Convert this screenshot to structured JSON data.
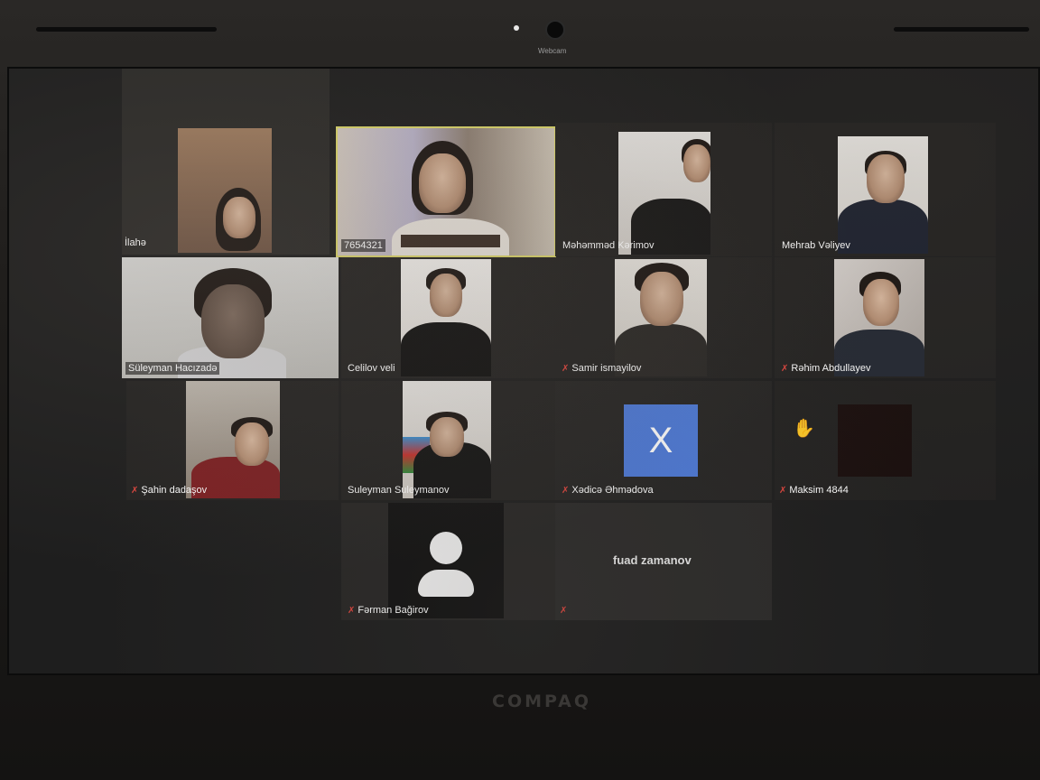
{
  "device": {
    "webcam_label": "Webcam",
    "brand": "COMPAQ"
  },
  "participants": [
    {
      "name": "İlahə"
    },
    {
      "name": "7654321"
    },
    {
      "name": "Məhəmməd Kərimov"
    },
    {
      "name": "Mehrab Vəliyev"
    },
    {
      "name": "Süleyman Hacızadə"
    },
    {
      "name": "Celilov veli"
    },
    {
      "name": "Samir ismayilov"
    },
    {
      "name": "Rəhim Abdullayev"
    },
    {
      "name": "Şahin dadaşov"
    },
    {
      "name": "Suleyman Suleymanov"
    },
    {
      "name": "Xədicə Əhmədova",
      "avatar_letter": "X"
    },
    {
      "name": "Maksim 4844"
    },
    {
      "name": "Fərman Bağirov"
    },
    {
      "name": "fuad zamanov"
    }
  ],
  "colors": {
    "active_speaker_border": "#d8d36a",
    "avatar_blue": "#4d7ad8",
    "muted_icon": "#e0453e"
  },
  "icons": {
    "muted": "microphone-muted-icon",
    "raised_hand": "raised-hand-icon",
    "default_avatar": "person-avatar-icon"
  }
}
